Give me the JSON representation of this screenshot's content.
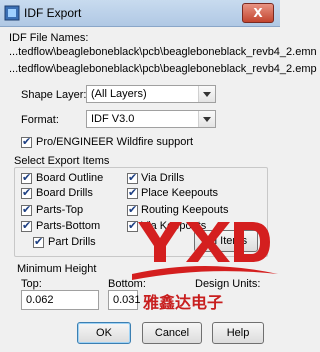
{
  "window": {
    "title": "IDF Export",
    "close_label": "X"
  },
  "file_names": {
    "label": "IDF File Names:",
    "paths": [
      "...tedflow\\beagleboneblack\\pcb\\beagleboneblack_revb4_2.emn",
      "...tedflow\\beagleboneblack\\pcb\\beagleboneblack_revb4_2.emp"
    ]
  },
  "shape_layer": {
    "label": "Shape Layer:",
    "value": "(All Layers)"
  },
  "format": {
    "label": "Format:",
    "value": "IDF V3.0"
  },
  "proe": {
    "label": "Pro/ENGINEER Wildfire support",
    "checked": true
  },
  "export_items": {
    "group_label": "Select Export Items",
    "left": [
      {
        "label": "Board Outline",
        "checked": true
      },
      {
        "label": "Board Drills",
        "checked": true
      },
      {
        "label": "Parts-Top",
        "checked": true
      },
      {
        "label": "Parts-Bottom",
        "checked": true
      },
      {
        "label": "Part Drills",
        "checked": true
      }
    ],
    "right": [
      {
        "label": "Via Drills",
        "checked": true
      },
      {
        "label": "Place Keepouts",
        "checked": true
      },
      {
        "label": "Routing Keepouts",
        "checked": true
      },
      {
        "label": "Via Keepouts",
        "checked": true
      }
    ],
    "all_items_label": "All Items"
  },
  "min_height": {
    "group_label": "Minimum Height",
    "top_label": "Top:",
    "top_value": "0.062",
    "bottom_label": "Bottom:",
    "bottom_value": "0.031",
    "units_label": "Design Units:"
  },
  "buttons": {
    "ok": "OK",
    "cancel": "Cancel",
    "help": "Help"
  },
  "watermark": {
    "text": "雅鑫达电子",
    "logo_color": "#d41f1f"
  }
}
